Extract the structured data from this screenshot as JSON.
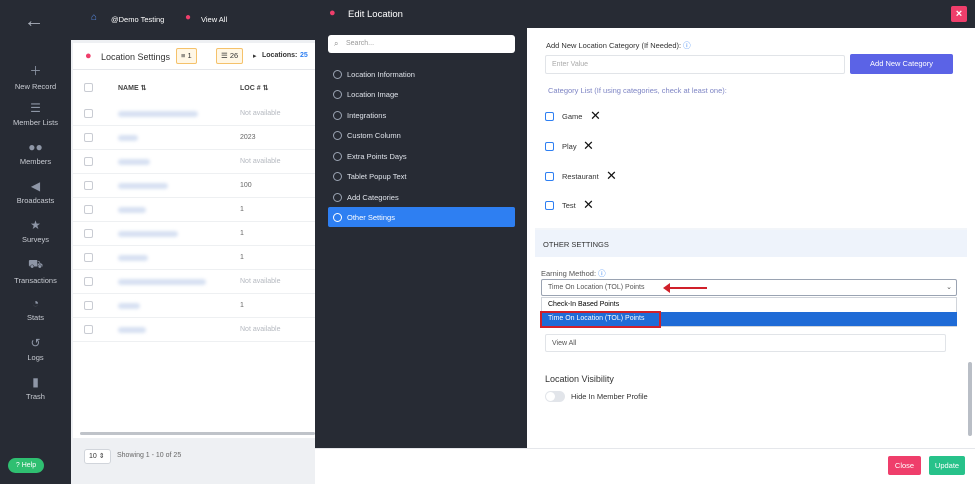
{
  "sidebar": {
    "items": [
      {
        "label": "New Record",
        "icon": "plus-icon"
      },
      {
        "label": "Member Lists",
        "icon": "list-icon"
      },
      {
        "label": "Members",
        "icon": "users-icon"
      },
      {
        "label": "Broadcasts",
        "icon": "megaphone-icon"
      },
      {
        "label": "Surveys",
        "icon": "star-icon"
      },
      {
        "label": "Transactions",
        "icon": "cart-icon"
      },
      {
        "label": "Stats",
        "icon": "pie-icon"
      },
      {
        "label": "Logs",
        "icon": "history-icon"
      },
      {
        "label": "Trash",
        "icon": "trash-icon"
      }
    ],
    "help": "Help"
  },
  "topbar": {
    "account": "@Demo Testing",
    "view": "View All"
  },
  "list": {
    "title": "Location Settings",
    "filter_count": "1",
    "list_count": "26",
    "locations_label": "Locations:",
    "locations_count": "25",
    "col_name": "NAME",
    "col_loc": "LOC #",
    "rows": [
      "Not available",
      "2023",
      "Not available",
      "100",
      "1",
      "1",
      "1",
      "Not available",
      "1",
      "Not available"
    ],
    "page_size": "10",
    "showing": "Showing 1 - 10 of 25"
  },
  "modal": {
    "title": "Edit Location",
    "search_placeholder": "Search...",
    "nav": [
      "Location Information",
      "Location Image",
      "Integrations",
      "Custom Column",
      "Extra Points Days",
      "Tablet Popup Text",
      "Add Categories",
      "Other Settings"
    ],
    "add_category_label": "Add New Location Category (If Needed):",
    "add_category_placeholder": "Enter Value",
    "add_category_button": "Add New Category",
    "category_list_label": "Category List (If using categories, check at least one):",
    "categories": [
      "Game",
      "Play",
      "Restaurant",
      "Test"
    ],
    "other_settings_heading": "OTHER SETTINGS",
    "earning_method_label": "Earning Method:",
    "earning_method_value": "Time On Location (TOL) Points",
    "earning_options": [
      "Check-In Based Points",
      "Time On Location (TOL) Points"
    ],
    "view_value": "View All",
    "visibility_heading": "Location Visibility",
    "hide_member_label": "Hide In Member Profile",
    "close_button": "Close",
    "update_button": "Update",
    "close_x": "×"
  }
}
